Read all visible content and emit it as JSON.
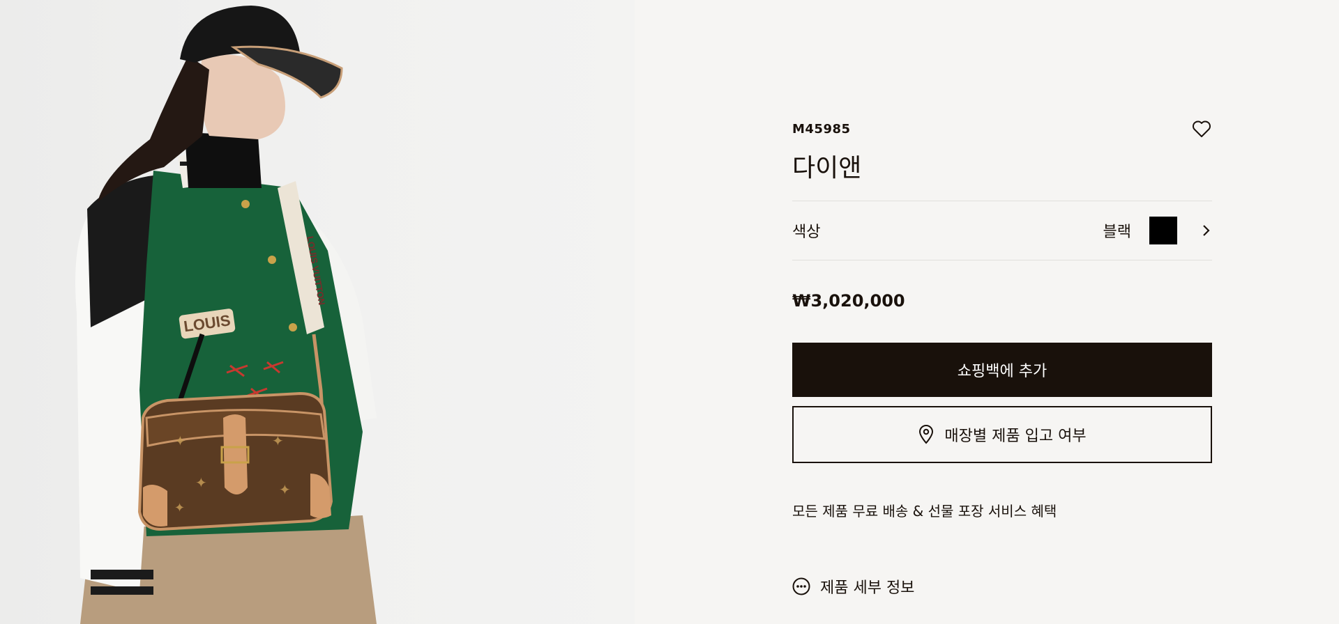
{
  "product": {
    "sku": "M45985",
    "title": "다이앤",
    "price": "₩3,020,000"
  },
  "color": {
    "label": "색상",
    "value": "블랙",
    "swatch_hex": "#000000"
  },
  "actions": {
    "add_to_bag": "쇼핑백에 추가",
    "store_availability": "매장별 제품 입고 여부"
  },
  "benefits_text": "모든 제품 무료 배송 & 선물 포장 서비스 혜택",
  "details_link": "제품 세부 정보",
  "image": {
    "jacket_patch_text": "LOUIS",
    "strap_text": "LOUIS VUITTON"
  },
  "icons": {
    "wishlist": "heart-icon",
    "color_next": "chevron-right-icon",
    "store": "location-pin-icon",
    "details": "more-dots-icon"
  },
  "colors": {
    "primary_dark": "#19110b",
    "background": "#f6f5f3",
    "image_background": "#efefee"
  }
}
